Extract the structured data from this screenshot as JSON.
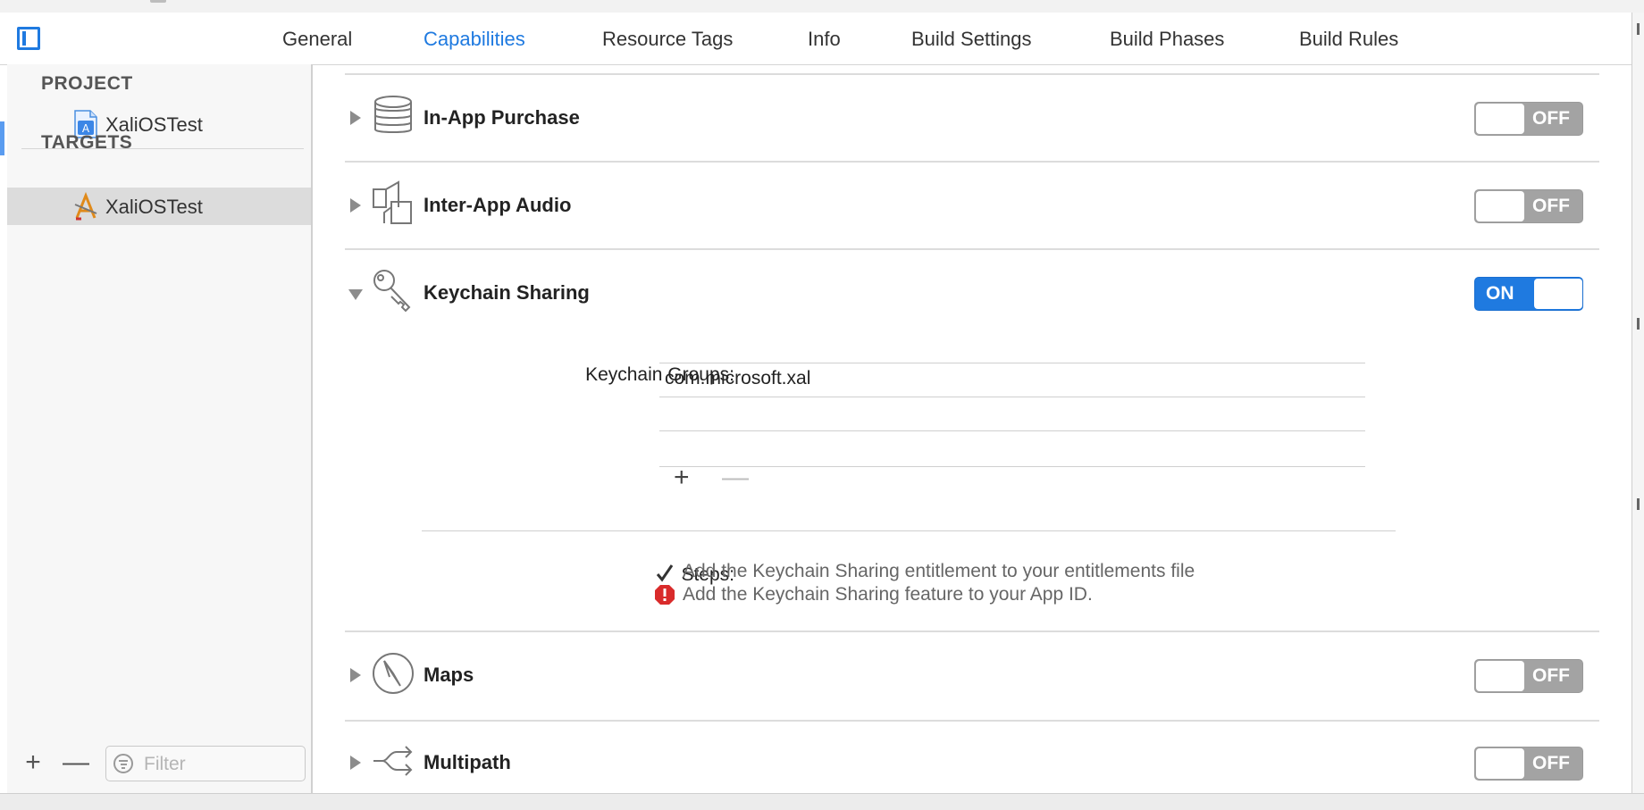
{
  "tabs": [
    {
      "label": "General"
    },
    {
      "label": "Capabilities"
    },
    {
      "label": "Resource Tags"
    },
    {
      "label": "Info"
    },
    {
      "label": "Build Settings"
    },
    {
      "label": "Build Phases"
    },
    {
      "label": "Build Rules"
    }
  ],
  "active_tab": "Capabilities",
  "sidebar": {
    "project_heading": "PROJECT",
    "project_item": "XaliOSTest",
    "targets_heading": "TARGETS",
    "target_item": "XaliOSTest",
    "filter_placeholder": "Filter",
    "add_symbol": "+",
    "remove_symbol": "—"
  },
  "capabilities": [
    {
      "title": "In-App Purchase",
      "state": "OFF",
      "icon": "database-stack-icon"
    },
    {
      "title": "Inter-App Audio",
      "state": "OFF",
      "icon": "audio-connector-icon"
    },
    {
      "title": "Keychain Sharing",
      "state": "ON",
      "icon": "key-icon"
    },
    {
      "title": "Maps",
      "state": "OFF",
      "icon": "compass-icon"
    },
    {
      "title": "Multipath",
      "state": "OFF",
      "icon": "multipath-arrows-icon"
    }
  ],
  "keychain": {
    "groups_label": "Keychain Groups:",
    "groups": [
      "com.microsoft.xal"
    ],
    "add_symbol": "+",
    "remove_symbol": "—",
    "steps_label": "Steps:",
    "steps": [
      {
        "status": "done",
        "icon": "checkmark-icon",
        "text": "Add the Keychain Sharing entitlement to your entitlements file"
      },
      {
        "status": "error",
        "icon": "error-icon",
        "text": "Add the Keychain Sharing feature to your App ID."
      }
    ]
  },
  "colors": {
    "accent": "#1f7ae0",
    "switch_off": "#a3a3a3",
    "error": "#d92b2b"
  }
}
